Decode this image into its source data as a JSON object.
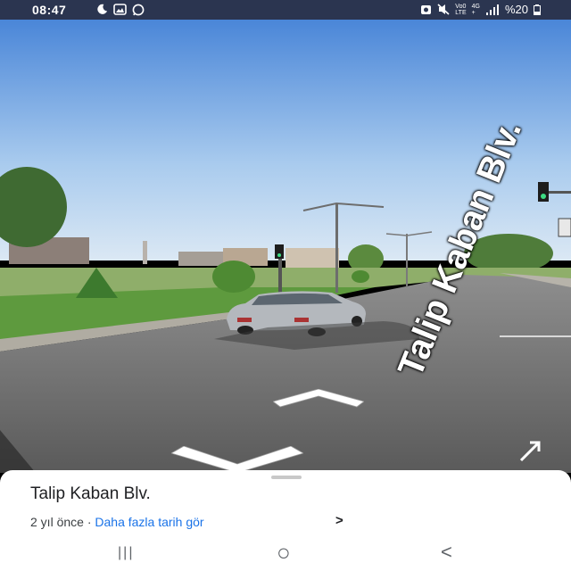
{
  "status_bar": {
    "time": "08:47",
    "left_icons": [
      "moon-icon",
      "image-icon",
      "whatsapp-icon"
    ],
    "net_top": "Vo0",
    "net_bottom": "LTE",
    "signal_type_top": "4G",
    "signal_type_bottom": "+",
    "battery": "%20"
  },
  "street_view": {
    "road_label": "Talip Kaban Blv."
  },
  "sheet": {
    "title": "Talip Kaban Blv.",
    "date": "2 yıl önce",
    "separator": "·",
    "more_history": "Daha fazla tarih gör",
    "chevron": ">"
  },
  "nav_bar": {
    "recents": "|||",
    "home": "○",
    "back": "<"
  }
}
